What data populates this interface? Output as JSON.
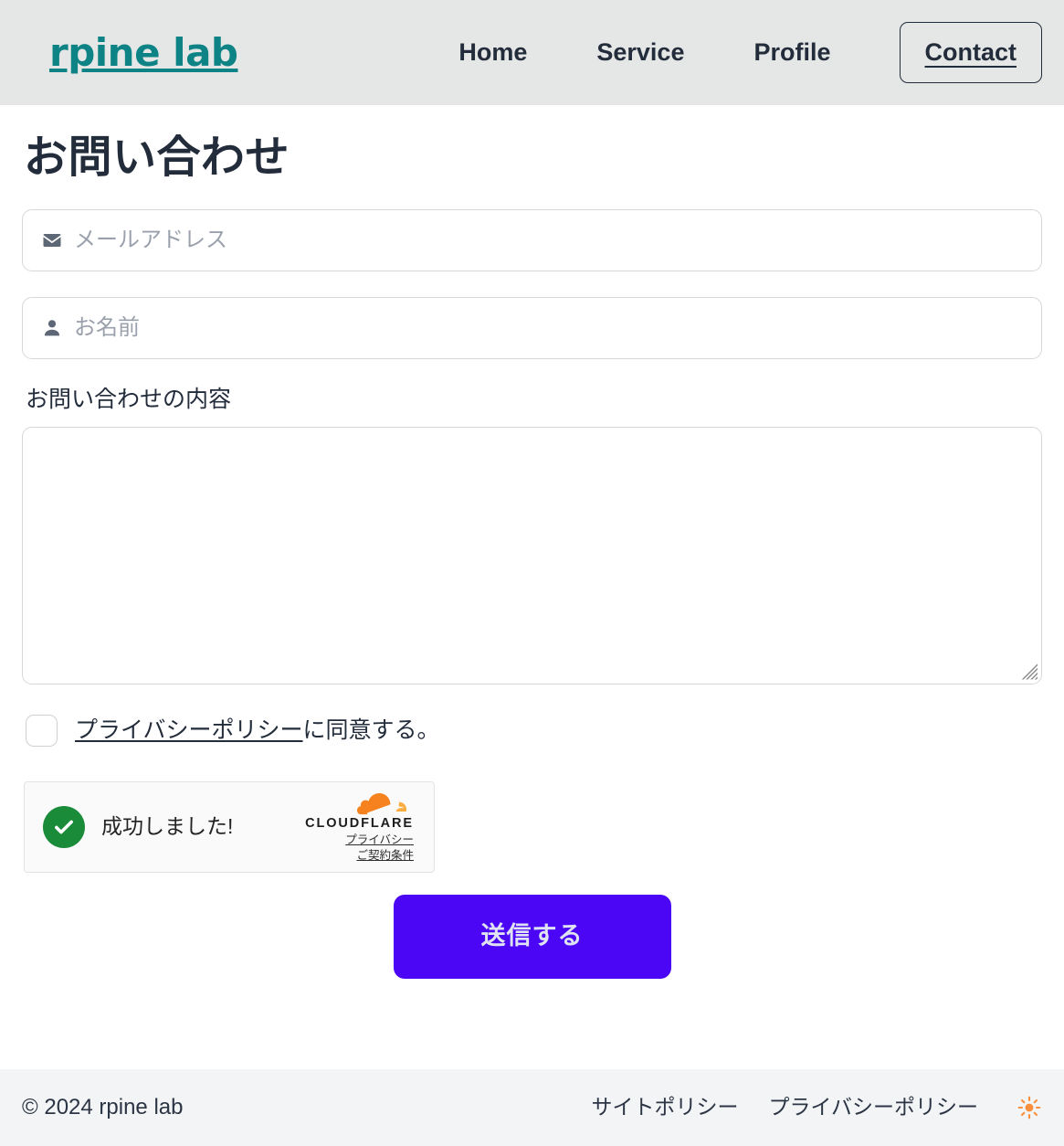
{
  "header": {
    "brand": "rpine lab",
    "nav": [
      {
        "label": "Home",
        "active": false
      },
      {
        "label": "Service",
        "active": false
      },
      {
        "label": "Profile",
        "active": false
      },
      {
        "label": "Contact",
        "active": true
      }
    ]
  },
  "main": {
    "page_title": "お問い合わせ",
    "email_field": {
      "placeholder": "メールアドレス",
      "value": "",
      "icon": "envelope-icon"
    },
    "name_field": {
      "placeholder": "お名前",
      "value": "",
      "icon": "person-icon"
    },
    "message": {
      "label": "お問い合わせの内容",
      "value": "",
      "placeholder": ""
    },
    "consent": {
      "checked": false,
      "link_text": "プライバシーポリシー",
      "suffix_text": "に同意する。"
    },
    "turnstile": {
      "status_text": "成功しました!",
      "brand_text": "CLOUDFLARE",
      "privacy_link": "プライバシー",
      "terms_link": "ご契約条件",
      "success_color": "#198b39",
      "brand_color": "#f6821f"
    },
    "submit": {
      "label": "送信する",
      "bg_color": "#4a06f5",
      "text_color": "#dfe2f2"
    }
  },
  "footer": {
    "copyright": "© 2024 rpine lab",
    "links": [
      {
        "label": "サイトポリシー"
      },
      {
        "label": "プライバシーポリシー"
      }
    ],
    "theme_toggle_icon": "sun-icon",
    "theme_toggle_color": "#f98f3d"
  },
  "theme": {
    "header_bg": "#e5e7e6",
    "footer_bg": "#f2f4f5",
    "brand_color": "#0e8385",
    "text_color": "#232c3b"
  }
}
